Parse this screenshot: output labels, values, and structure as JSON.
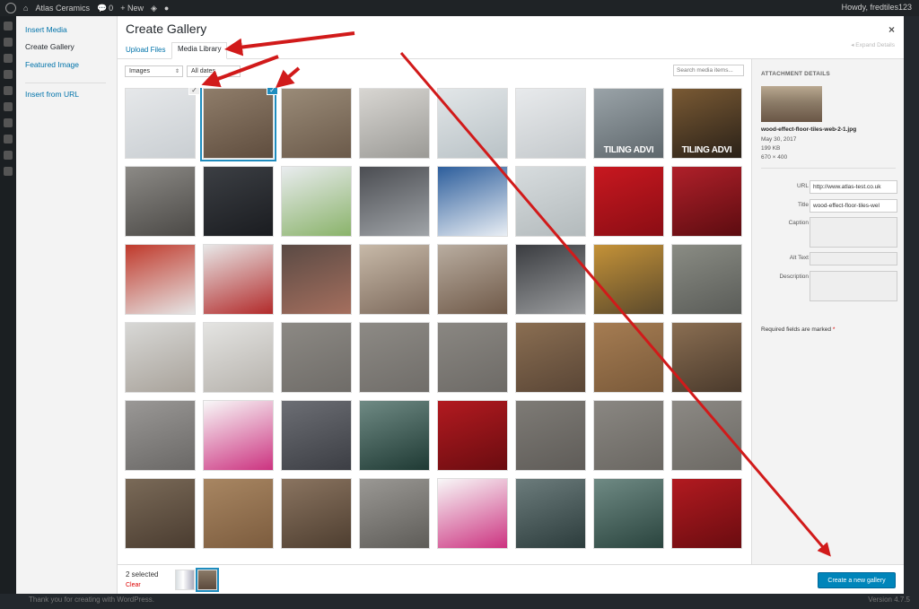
{
  "admin_bar": {
    "site_name": "Atlas Ceramics",
    "comments_count": "0",
    "new_label": "+ New",
    "howdy": "Howdy, fredtiles123"
  },
  "footer": {
    "left": "Thank you for creating with WordPress.",
    "right": "Version 4.7.5"
  },
  "menu": {
    "items": [
      {
        "label": "Insert Media"
      },
      {
        "label": "Create Gallery",
        "active": true
      },
      {
        "label": "Featured Image"
      },
      {
        "label": "Insert from URL"
      }
    ]
  },
  "frame": {
    "title": "Create Gallery",
    "close": "×",
    "tabs": [
      {
        "label": "Upload Files"
      },
      {
        "label": "Media Library",
        "active": true
      }
    ],
    "expand_details": "Expand Details"
  },
  "toolbar": {
    "type_filter": "Images",
    "date_filter": "All dates",
    "search_placeholder": "Search media items..."
  },
  "grid": {
    "overlay_text": "TILING ADVI",
    "tiles": [
      {
        "c": "#e6e8ea",
        "c2": "#c9ced2",
        "sel": "unchecked"
      },
      {
        "c": "#8f7d6a",
        "c2": "#5f4d3e",
        "sel": "checked"
      },
      {
        "c": "#9a8b78",
        "c2": "#6b5a4a"
      },
      {
        "c": "#d8d6d2",
        "c2": "#9b9a96"
      },
      {
        "c": "#e2e6e8",
        "c2": "#b9c2c6"
      },
      {
        "c": "#e8eaec",
        "c2": "#c4c9cc"
      },
      {
        "c": "#9aa3a8",
        "c2": "#5e676c",
        "ov": true
      },
      {
        "c": "#7a5a34",
        "c2": "#2a2118",
        "ov": true
      },
      {
        "c": "#8c8a86",
        "c2": "#4b4946"
      },
      {
        "c": "#3c3f44",
        "c2": "#1a1c20"
      },
      {
        "c": "#e9ecef",
        "c2": "#8ab36a"
      },
      {
        "c": "#4b4d52",
        "c2": "#a0a4a8"
      },
      {
        "c": "#2d5e9c",
        "c2": "#e9eef4"
      },
      {
        "c": "#d7dcde",
        "c2": "#b3babc"
      },
      {
        "c": "#c81820",
        "c2": "#8a0d14"
      },
      {
        "c": "#b0202a",
        "c2": "#5c0c10"
      },
      {
        "c": "#c0392b",
        "c2": "#e6e6e6"
      },
      {
        "c": "#e8e8e8",
        "c2": "#b22a2a"
      },
      {
        "c": "#5a4a44",
        "c2": "#a56f5e"
      },
      {
        "c": "#c7b9a8",
        "c2": "#7d6a5c"
      },
      {
        "c": "#b9ada0",
        "c2": "#6f5948"
      },
      {
        "c": "#3a3c40",
        "c2": "#9a9c9e"
      },
      {
        "c": "#c49238",
        "c2": "#5c4a2c"
      },
      {
        "c": "#8a8c84",
        "c2": "#5a5c58"
      },
      {
        "c": "#d8d8d6",
        "c2": "#a8a29a"
      },
      {
        "c": "#e4e4e2",
        "c2": "#b6b2ac"
      },
      {
        "c": "#8c8984",
        "c2": "#6f6c68"
      },
      {
        "c": "#8d8a85",
        "c2": "#706d69"
      },
      {
        "c": "#8a8782",
        "c2": "#6d6a66"
      },
      {
        "c": "#8a6e52",
        "c2": "#5a4636"
      },
      {
        "c": "#a57c52",
        "c2": "#7a5a3a"
      },
      {
        "c": "#8a6e52",
        "c2": "#4a3a2c"
      },
      {
        "c": "#9a9896",
        "c2": "#6a6866"
      },
      {
        "c": "#f8f8f8",
        "c2": "#cc3380"
      },
      {
        "c": "#6c6e74",
        "c2": "#3c3e44"
      },
      {
        "c": "#6f8a84",
        "c2": "#1f3a34"
      },
      {
        "c": "#b21a20",
        "c2": "#6a0c10"
      },
      {
        "c": "#7e7b76",
        "c2": "#5f5c58"
      },
      {
        "c": "#8a8782",
        "c2": "#6a6762"
      },
      {
        "c": "#8c8984",
        "c2": "#6c6964"
      },
      {
        "c": "#7a6a58",
        "c2": "#4a3c30"
      },
      {
        "c": "#a88662",
        "c2": "#7c5c3e"
      },
      {
        "c": "#8a7460",
        "c2": "#4e3e30"
      },
      {
        "c": "#9a9894",
        "c2": "#5e5c58"
      },
      {
        "c": "#f8f8f8",
        "c2": "#cc3380"
      },
      {
        "c": "#6c7c7c",
        "c2": "#2c3c3c"
      },
      {
        "c": "#6f8a84",
        "c2": "#2a443e"
      },
      {
        "c": "#b21a20",
        "c2": "#6a0c10"
      },
      {
        "c": "#8a8680",
        "c2": "#6e6a64"
      },
      {
        "c": "#9a9690",
        "c2": "#7a7670"
      },
      {
        "c": "#8a8680",
        "c2": "#6a6660"
      },
      {
        "c": "#a09c96",
        "c2": "#807c76"
      },
      {
        "c": "#b0aca6",
        "c2": "#908c86"
      },
      {
        "c": "#9e9a94",
        "c2": "#7e7a74"
      },
      {
        "c": "#eaeaea",
        "c2": "#c6c6c6"
      },
      {
        "c": "#9a9690",
        "c2": "#7a7670"
      }
    ]
  },
  "details": {
    "heading": "ATTACHMENT DETAILS",
    "filename": "wood-effect-floor-tiles-web-2-1.jpg",
    "date": "May 30, 2017",
    "size": "199 KB",
    "dimensions": "670 × 400",
    "fields": [
      {
        "label": "URL",
        "value": "http://www.atlas-test.co.uk"
      },
      {
        "label": "Title",
        "value": "wood-effect-floor-tiles-wel"
      },
      {
        "label": "Caption",
        "value": ""
      },
      {
        "label": "Alt Text",
        "value": ""
      },
      {
        "label": "Description",
        "value": ""
      }
    ],
    "required_note": "Required fields are marked",
    "required_star": "*"
  },
  "bottom": {
    "selected_count": "2 selected",
    "clear": "Clear",
    "cta": "Create a new gallery"
  },
  "annotation": {
    "arrow_color": "#d11a1a"
  }
}
